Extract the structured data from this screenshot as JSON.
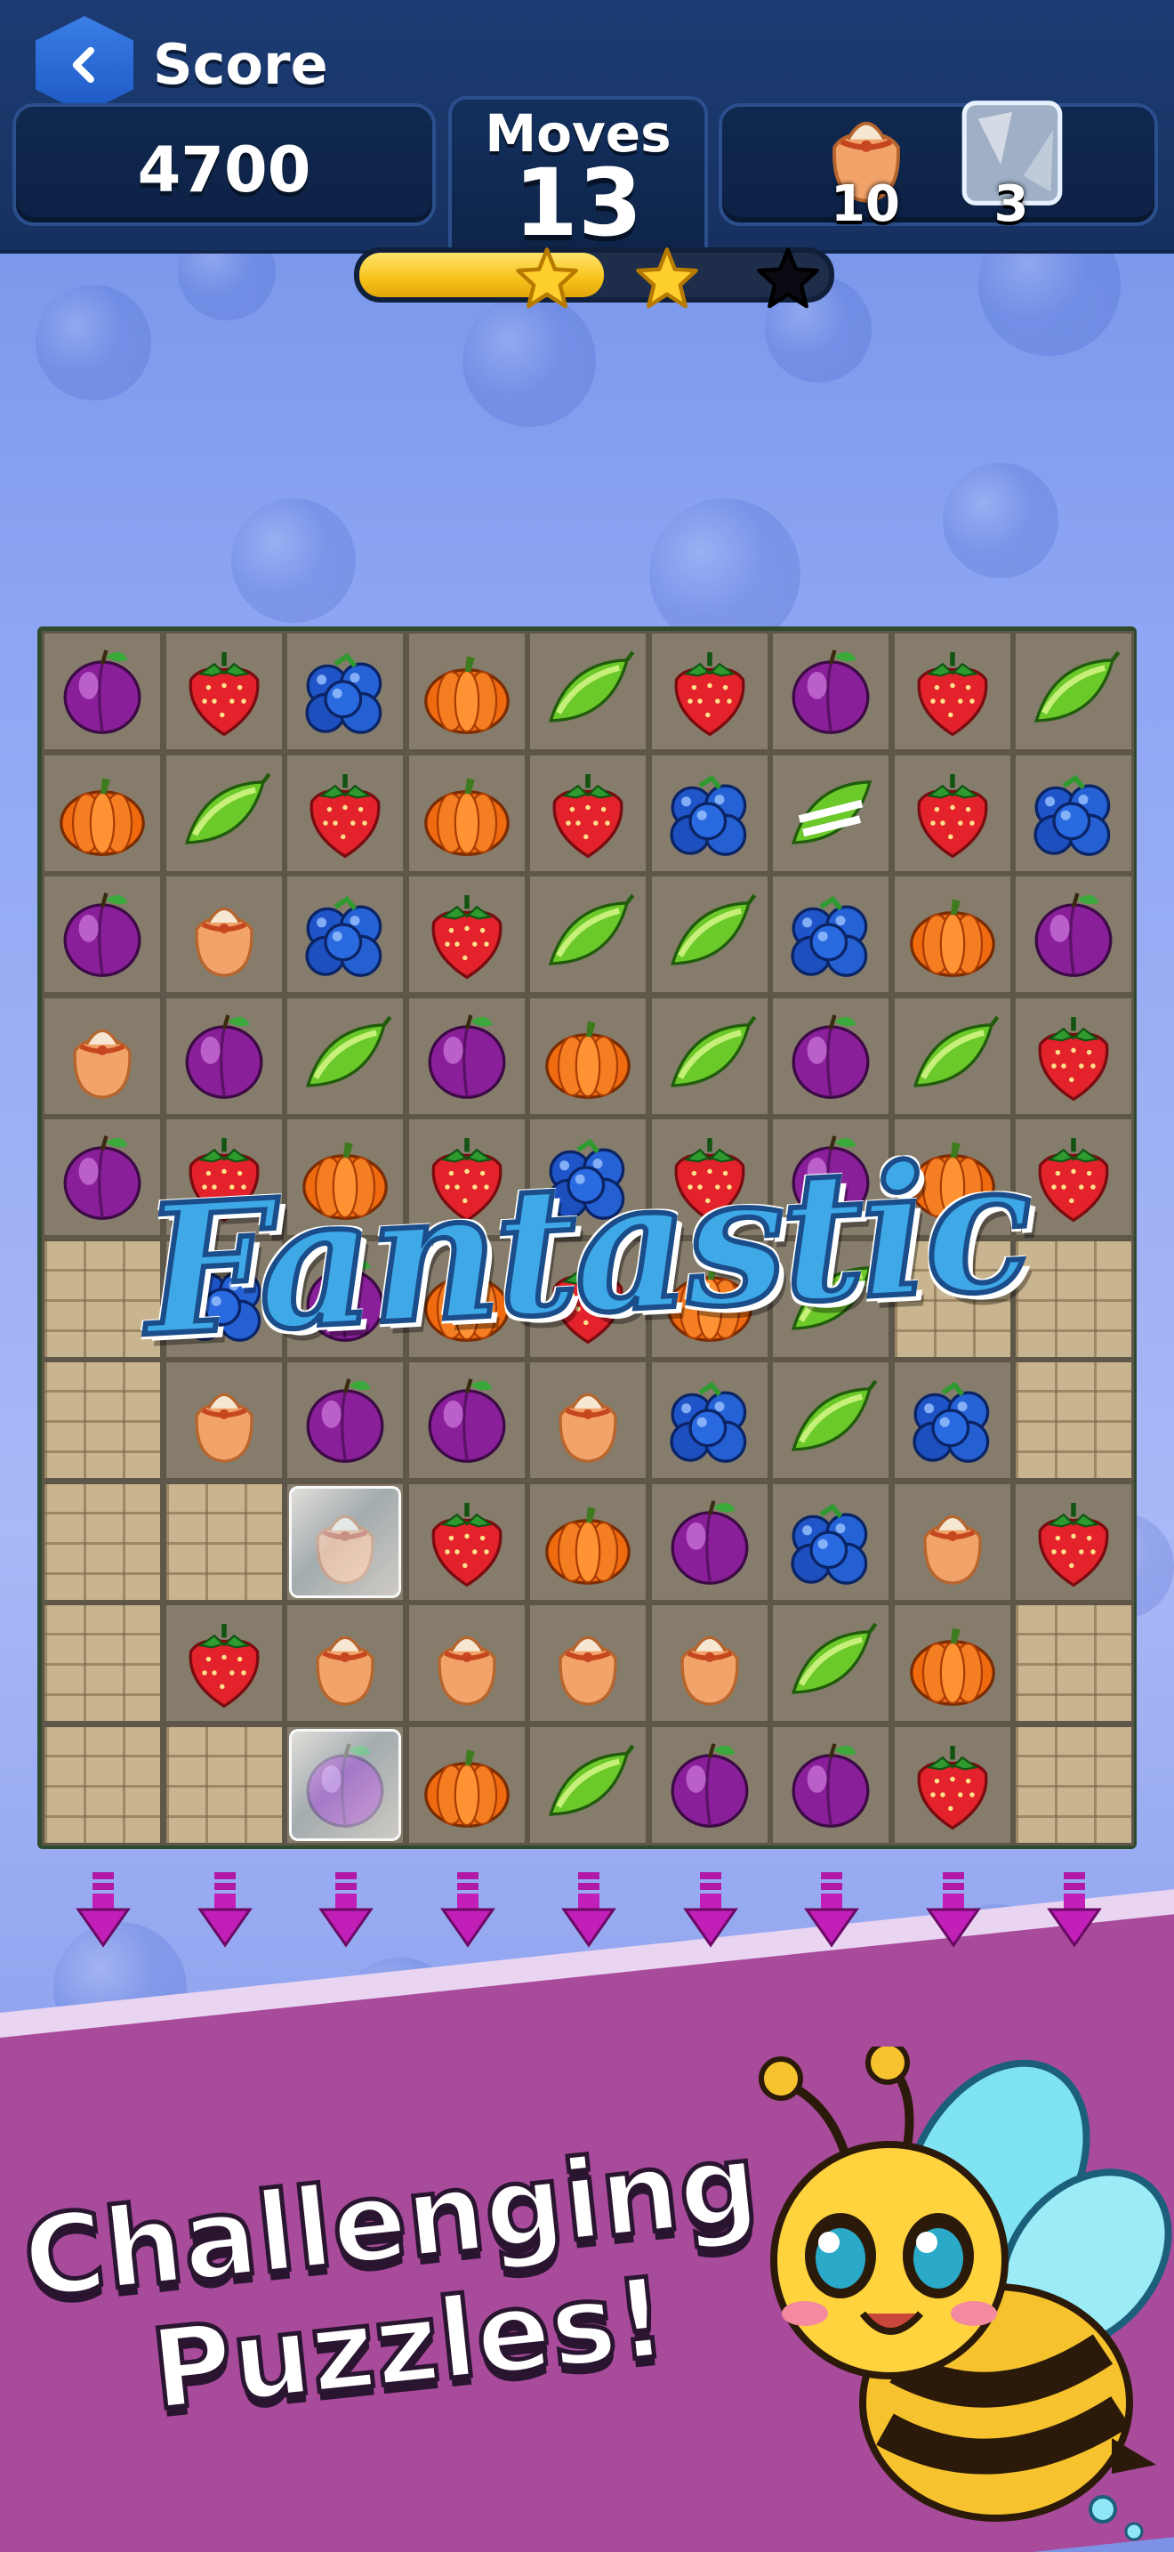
{
  "hud": {
    "score_label": "Score",
    "score_value": "4700",
    "moves_label": "Moves",
    "moves_value": "13",
    "goals": [
      {
        "icon": "flour-sack-icon",
        "count": "10"
      },
      {
        "icon": "ice-block-icon",
        "count": "3"
      }
    ]
  },
  "progress": {
    "fraction": 0.52,
    "stars": [
      {
        "earned": true
      },
      {
        "earned": true
      },
      {
        "earned": false
      }
    ]
  },
  "board": {
    "rows": [
      [
        "plum",
        "strawberry",
        "blueberry",
        "pumpkin",
        "peapod",
        "strawberry",
        "plum",
        "strawberry",
        "peapod"
      ],
      [
        "pumpkin",
        "peapod",
        "strawberry",
        "pumpkin",
        "strawberry",
        "blueberry",
        "peapod-striped",
        "strawberry",
        "blueberry"
      ],
      [
        "plum",
        "sack",
        "blueberry",
        "strawberry",
        "peapod",
        "peapod",
        "blueberry",
        "pumpkin",
        "plum"
      ],
      [
        "sack",
        "plum",
        "peapod",
        "plum",
        "pumpkin",
        "peapod",
        "plum",
        "peapod",
        "strawberry"
      ],
      [
        "plum",
        "strawberry",
        "pumpkin",
        "strawberry",
        "blueberry",
        "strawberry",
        "plum",
        "pumpkin",
        "strawberry"
      ],
      [
        "stone",
        "blueberry",
        "plum",
        "pumpkin",
        "strawberry",
        "pumpkin",
        "peapod",
        "stone",
        "stone"
      ],
      [
        "stone",
        "sack",
        "plum",
        "plum",
        "sack",
        "blueberry",
        "peapod",
        "blueberry",
        "stone"
      ],
      [
        "stone",
        "stone",
        "sack-ice",
        "strawberry",
        "pumpkin",
        "plum",
        "blueberry",
        "sack",
        "strawberry"
      ],
      [
        "stone",
        "strawberry",
        "sack",
        "sack",
        "sack",
        "sack",
        "peapod",
        "pumpkin",
        "stone"
      ],
      [
        "stone",
        "stone",
        "plum-ice",
        "pumpkin",
        "peapod",
        "plum",
        "plum",
        "strawberry",
        "stone"
      ]
    ]
  },
  "banner_text": "Fantastic",
  "promo": {
    "line1": "Challenging",
    "line2": "Puzzles!"
  },
  "colors": {
    "hud_bg": "#193668",
    "board_cell": "#857c6c",
    "promo_band": "#a84b9a",
    "progress_fill": "#f7c21a"
  }
}
